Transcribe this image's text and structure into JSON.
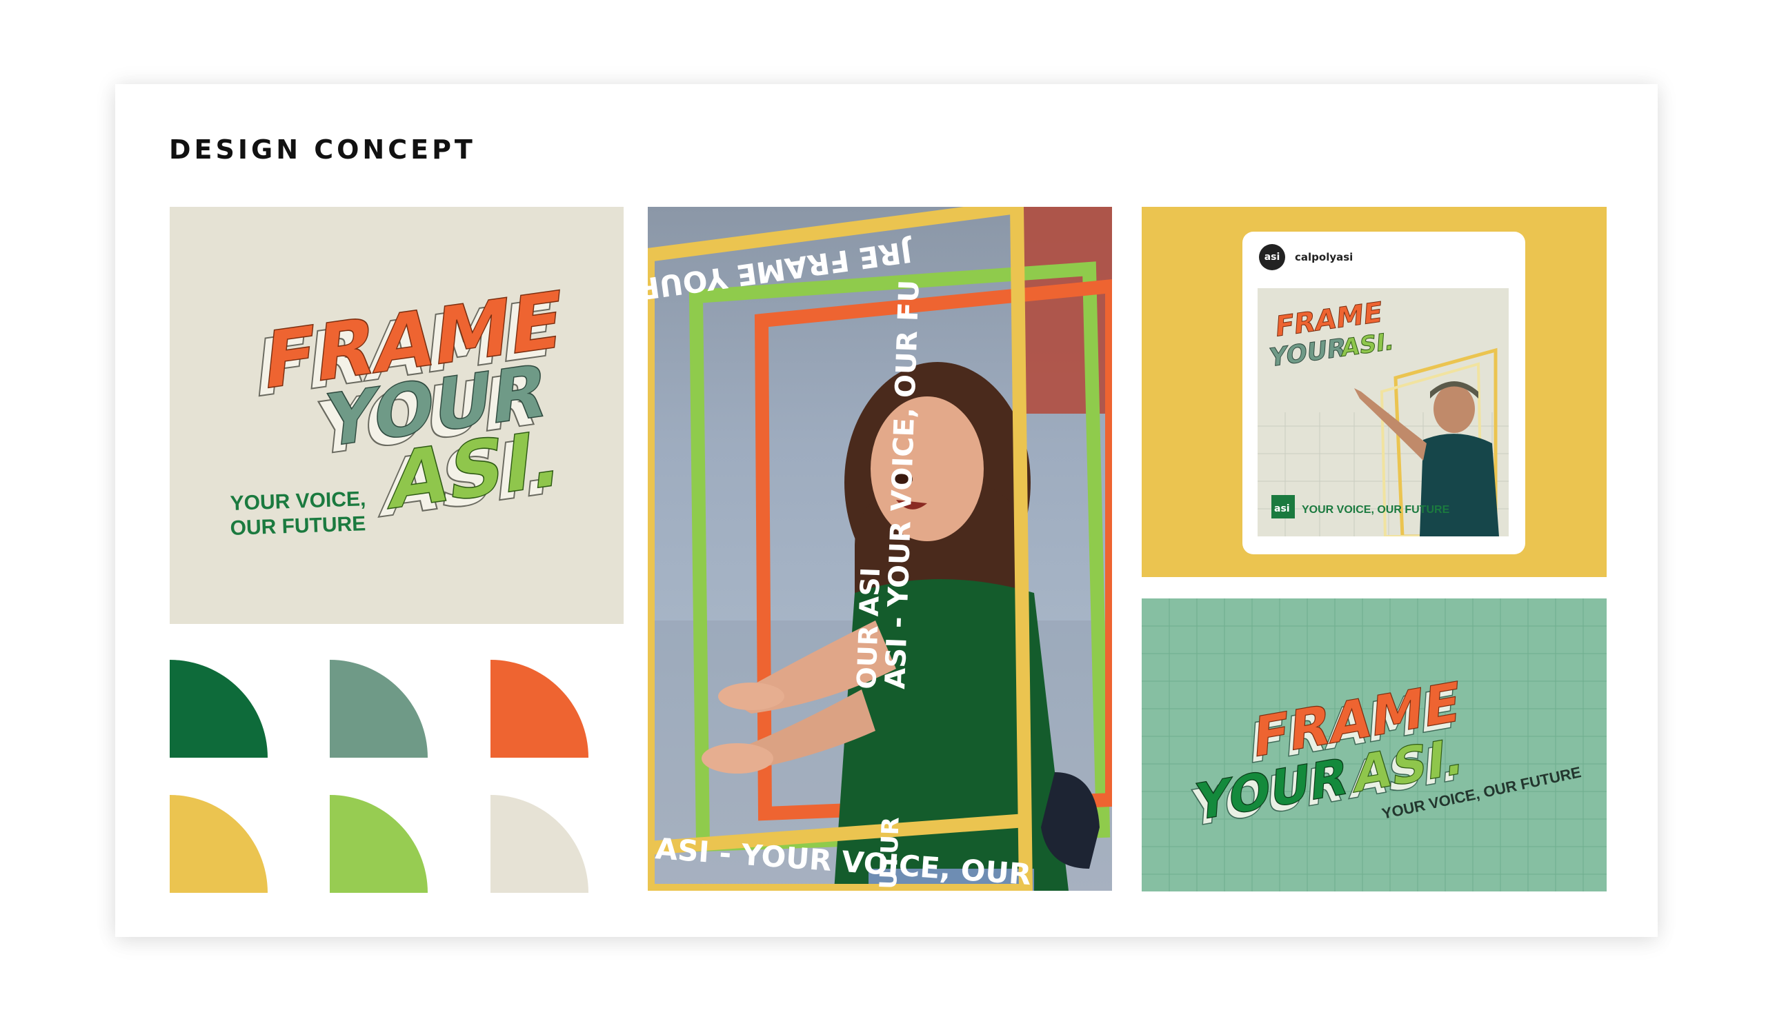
{
  "page": {
    "title": "DESIGN CONCEPT"
  },
  "campaign": {
    "word_frame": "FRAME",
    "word_your": "YOUR",
    "word_asi": "ASI.",
    "tagline_line1": "YOUR VOICE,",
    "tagline_line2": "OUR FUTURE",
    "tagline_single": "YOUR VOICE, OUR FUTURE",
    "ribbon_top": "JRE FRAME YOUR ASI",
    "ribbon_vertical": "ASI - YOUR VOICE, OUR FU",
    "ribbon_vertical_left": "OUR ASI",
    "ribbon_bottom": "ASI - YOUR VOICE, OUR",
    "ribbon_bottom_tail": "UTUR"
  },
  "instagram": {
    "avatar_label": "asi",
    "handle": "calpolyasi",
    "badge_label": "asi"
  },
  "palette": {
    "dark_green": "#0e6b3a",
    "sage": "#6f9a87",
    "orange": "#ee6431",
    "yellow": "#ebc450",
    "lime": "#97cc52",
    "cream": "#e6e2d5"
  }
}
